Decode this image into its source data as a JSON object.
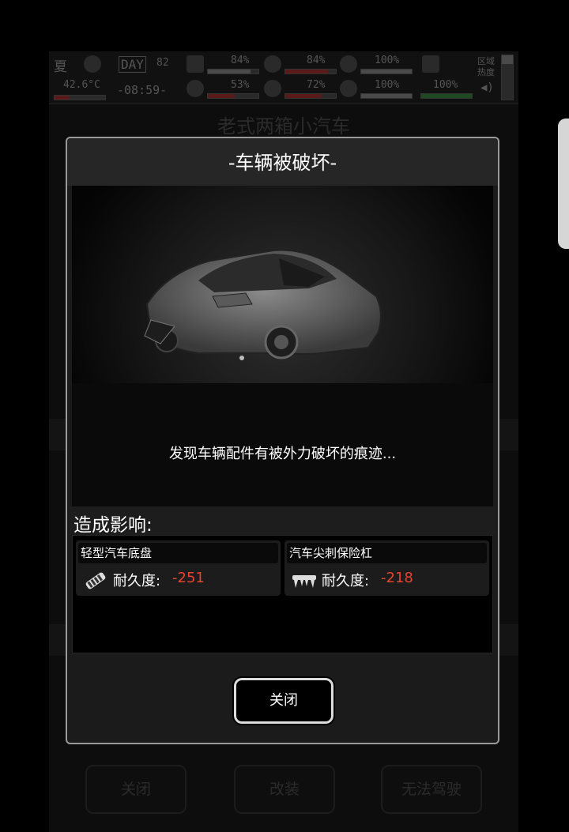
{
  "hud": {
    "season": "夏",
    "temperature": "42.6°C",
    "day_label": "DAY",
    "day_number": "82",
    "clock": "-08:59-",
    "stats": [
      {
        "name": "health",
        "value": "84%",
        "level": 0.84
      },
      {
        "name": "hunger",
        "value": "84%",
        "level": 0.84
      },
      {
        "name": "mood",
        "value": "100%",
        "level": 1.0
      },
      {
        "name": "stamina",
        "value": "53%",
        "level": 0.53
      },
      {
        "name": "thirst",
        "value": "72%",
        "level": 0.72
      },
      {
        "name": "heart",
        "value": "100%",
        "level": 1.0
      },
      {
        "name": "signal",
        "value": "100%",
        "level": 1.0
      }
    ],
    "region_heat_label": "区域热度"
  },
  "background": {
    "title": "老式两箱小汽车",
    "buttons": [
      "关闭",
      "改装",
      "无法驾驶"
    ]
  },
  "dialog": {
    "title": "-车辆被破坏-",
    "message": "发现车辆配件有被外力破坏的痕迹...",
    "effects_label": "造成影响:",
    "effects": [
      {
        "name": "轻型汽车底盘",
        "durability_label": "耐久度:",
        "durability_value": "-251",
        "icon": "chassis-icon"
      },
      {
        "name": "汽车尖刺保险杠",
        "durability_label": "耐久度:",
        "durability_value": "-218",
        "icon": "spiked-bumper-icon"
      }
    ],
    "close_label": "关闭"
  },
  "colors": {
    "negative": "#e8432e",
    "dialog_border": "#9a9a9a",
    "button_border": "#dcdcdc"
  }
}
